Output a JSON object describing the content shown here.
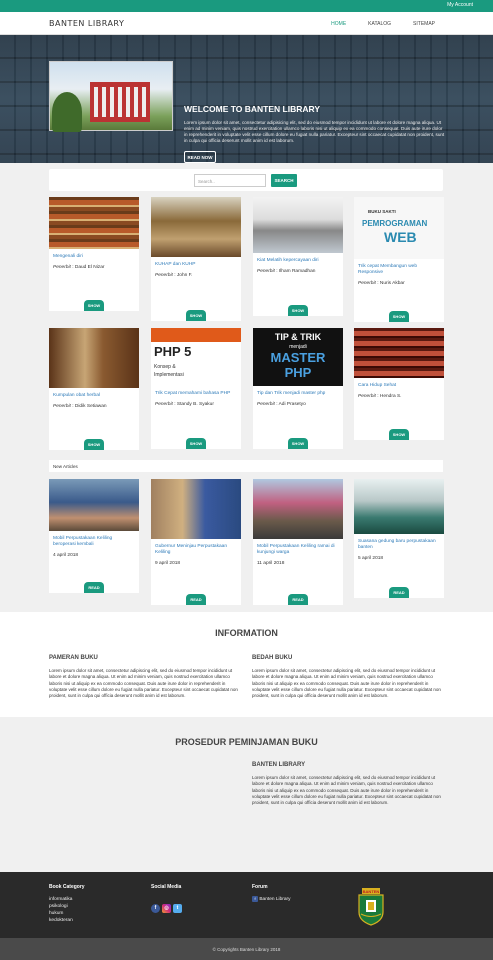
{
  "topbar": {
    "account": "My Account"
  },
  "nav": {
    "brand": "BANTEN LIBRARY",
    "links": [
      "HOME",
      "KATALOG",
      "SITEMAP"
    ],
    "active": "HOME"
  },
  "hero": {
    "title": "WELCOME TO BANTEN LIBRARY",
    "paragraph": "Lorem ipsum dolor sit amet, consectetur adipisicing elit, sed do eiusmod tempor incididunt ut labore et dolore magna aliqua. Ut enim ad minim veniam, quis nostrud exercitation ullamco laboris nisi ut aliquip ex ea commodo consequat. Duis aute irure dolor in reprehenderit in voluptate velit esse cillum dolore eu fugiat nulla pariatur. Excepteur sint occaecat cupidatat non proident, sunt in culpa qui officia deserunt mollit anim id est laborum.",
    "button": "READ NOW"
  },
  "search": {
    "placeholder": "Search..",
    "button": "SEARCH"
  },
  "books_row1": [
    {
      "title": "Mengenali diri",
      "author_label": "Penerbit",
      "author": "Daud El Nizar",
      "button": "SHOW"
    },
    {
      "title": "KUHAP dan KUHP",
      "author_label": "Penerbit",
      "author": "John F.",
      "button": "SHOW"
    },
    {
      "title": "Kiat Melatih kepercayaan diri",
      "author_label": "Penerbit",
      "author": "Ilham Ramadhan",
      "button": "SHOW"
    },
    {
      "title": "Trik cepat Membangun web Responsive",
      "author_label": "Penerbit",
      "author": "Nuris Akbar",
      "button": "SHOW",
      "cover_text": [
        "BUKU SAKTI",
        "PEMROGRAMAN",
        "WEB"
      ]
    }
  ],
  "books_row2": [
    {
      "title": "Kumpulan obat herbal",
      "author_label": "Penerbit",
      "author": "Didik Setiawan",
      "button": "SHOW"
    },
    {
      "title": "Trik Cepat memahami bahasa PHP",
      "author_label": "Penerbit",
      "author": "Standy B. Syakur",
      "button": "SHOW",
      "cover_text": [
        "PHP 5",
        "Konsep &",
        "Implementasi"
      ]
    },
    {
      "title": "Tip dan Trik menjadi master php",
      "author_label": "Penerbit",
      "author": "Adi Prasetyo",
      "button": "SHOW",
      "cover_text": [
        "TIP & TRIK",
        "menjadi",
        "MASTER",
        "PHP"
      ]
    },
    {
      "title": "Cara Hidup Sehat",
      "author_label": "Penerbit",
      "author": "Hendra S.",
      "button": "SHOW"
    }
  ],
  "articles_label": "New Articles",
  "articles": [
    {
      "title": "Mobil Perpustakaan Keliling beroperasi kembali",
      "date": "4 april 2018",
      "button": "READ"
    },
    {
      "title": "Gubernur Meninjau Perpustakaan Keliling",
      "date": "9 april 2018",
      "button": "READ"
    },
    {
      "title": "Mobil Perpustakaan Keliling ramai di kunjungi warga",
      "date": "11 april 2018",
      "button": "READ"
    },
    {
      "title": "Suasana gedung baru perpustakaan banten",
      "date": "5 april 2018",
      "button": "READ"
    }
  ],
  "information": {
    "heading": "INFORMATION",
    "col1_title": "PAMERAN BUKU",
    "col1_text": "Lorem ipsum dolor sit amet, consectetur adipiscing elit, sed do eiusmod tempor incididunt ut labore et dolore magna aliqua. Ut enim ad minim veniam, quis nostrud exercitation ullamco laboris nisi ut aliquip ex ea commodo consequat. Duis aute irure dolor in reprehenderit in voluptate velit esse cillum dolore eu fugiat nulla pariatur. Excepteur sint occaecat cupidatat non proident, sunt in culpa qui officia deserunt mollit anim id est laborum.",
    "col2_title": "BEDAH BUKU",
    "col2_text": "Lorem ipsum dolor sit amet, consectetur adipiscing elit, sed do eiusmod tempor incididunt ut labore et dolore magna aliqua. Ut enim ad minim veniam, quis nostrud exercitation ullamco laboris nisi ut aliquip ex ea commodo consequat. Duis aute irure dolor in reprehenderit in voluptate velit esse cillum dolore eu fugiat nulla pariatur. Excepteur sint occaecat cupidatat non proident, sunt in culpa qui officia deserunt mollit anim id est laborum."
  },
  "prosedur": {
    "heading": "PROSEDUR PEMINJAMAN BUKU",
    "title": "BANTEN LIBRARY",
    "text": "Lorem ipsum dolor sit amet, consectetur adipiscing elit, sed do eiusmod tempor incididunt ut labore et dolore magna aliqua. Ut enim ad minim veniam, quis nostrud exercitation ullamco laboris nisi ut aliquip ex ea commodo consequat. Duis aute irure dolor in reprehenderit in voluptate velit esse cillum dolore eu fugiat nulla pariatur. Excepteur sint occaecat cupidatat non proident, sunt in culpa qui officia deserunt mollit anim id est laborum."
  },
  "footer": {
    "category_title": "Book Category",
    "categories": [
      "informatika",
      "psikologi",
      "hukum",
      "kedokteran"
    ],
    "social_title": "Social Media",
    "social_icons": [
      "facebook-icon",
      "instagram-icon",
      "twitter-icon"
    ],
    "forum_title": "Forum",
    "forum_link": "Banten Library",
    "emblem_text": "BANTEN",
    "copyright": "© Copyrights Banten Library 2018"
  },
  "colors": {
    "accent": "#1a9a7f",
    "link": "#2d7ab8",
    "footer": "#2a2a2a"
  }
}
